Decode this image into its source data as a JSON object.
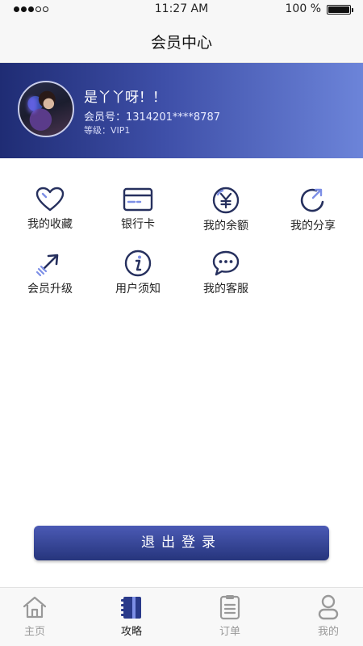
{
  "status_bar": {
    "time": "11:27 AM",
    "battery": "100 %"
  },
  "nav": {
    "title": "会员中心"
  },
  "profile": {
    "name": "是丫丫呀！！",
    "member_no": "会员号：1314201****8787",
    "level": "等级：VIP1"
  },
  "features": [
    {
      "label": "我的收藏",
      "icon": "heart-icon"
    },
    {
      "label": "银行卡",
      "icon": "bank-card-icon"
    },
    {
      "label": "我的余额",
      "icon": "yen-icon"
    },
    {
      "label": "我的分享",
      "icon": "share-icon"
    },
    {
      "label": "会员升级",
      "icon": "upgrade-arrow-icon"
    },
    {
      "label": "用户须知",
      "icon": "info-icon"
    },
    {
      "label": "我的客服",
      "icon": "chat-icon"
    }
  ],
  "logout_label": "退出登录",
  "tabs": [
    {
      "label": "主页",
      "icon": "home-icon",
      "active": false
    },
    {
      "label": "攻略",
      "icon": "notebook-icon",
      "active": true
    },
    {
      "label": "订单",
      "icon": "order-list-icon",
      "active": false
    },
    {
      "label": "我的",
      "icon": "user-icon",
      "active": false
    }
  ],
  "colors": {
    "accent": "#2a3a8a",
    "header_start": "#1f2c74",
    "header_end": "#6c84d9",
    "icon": "#26305e"
  }
}
